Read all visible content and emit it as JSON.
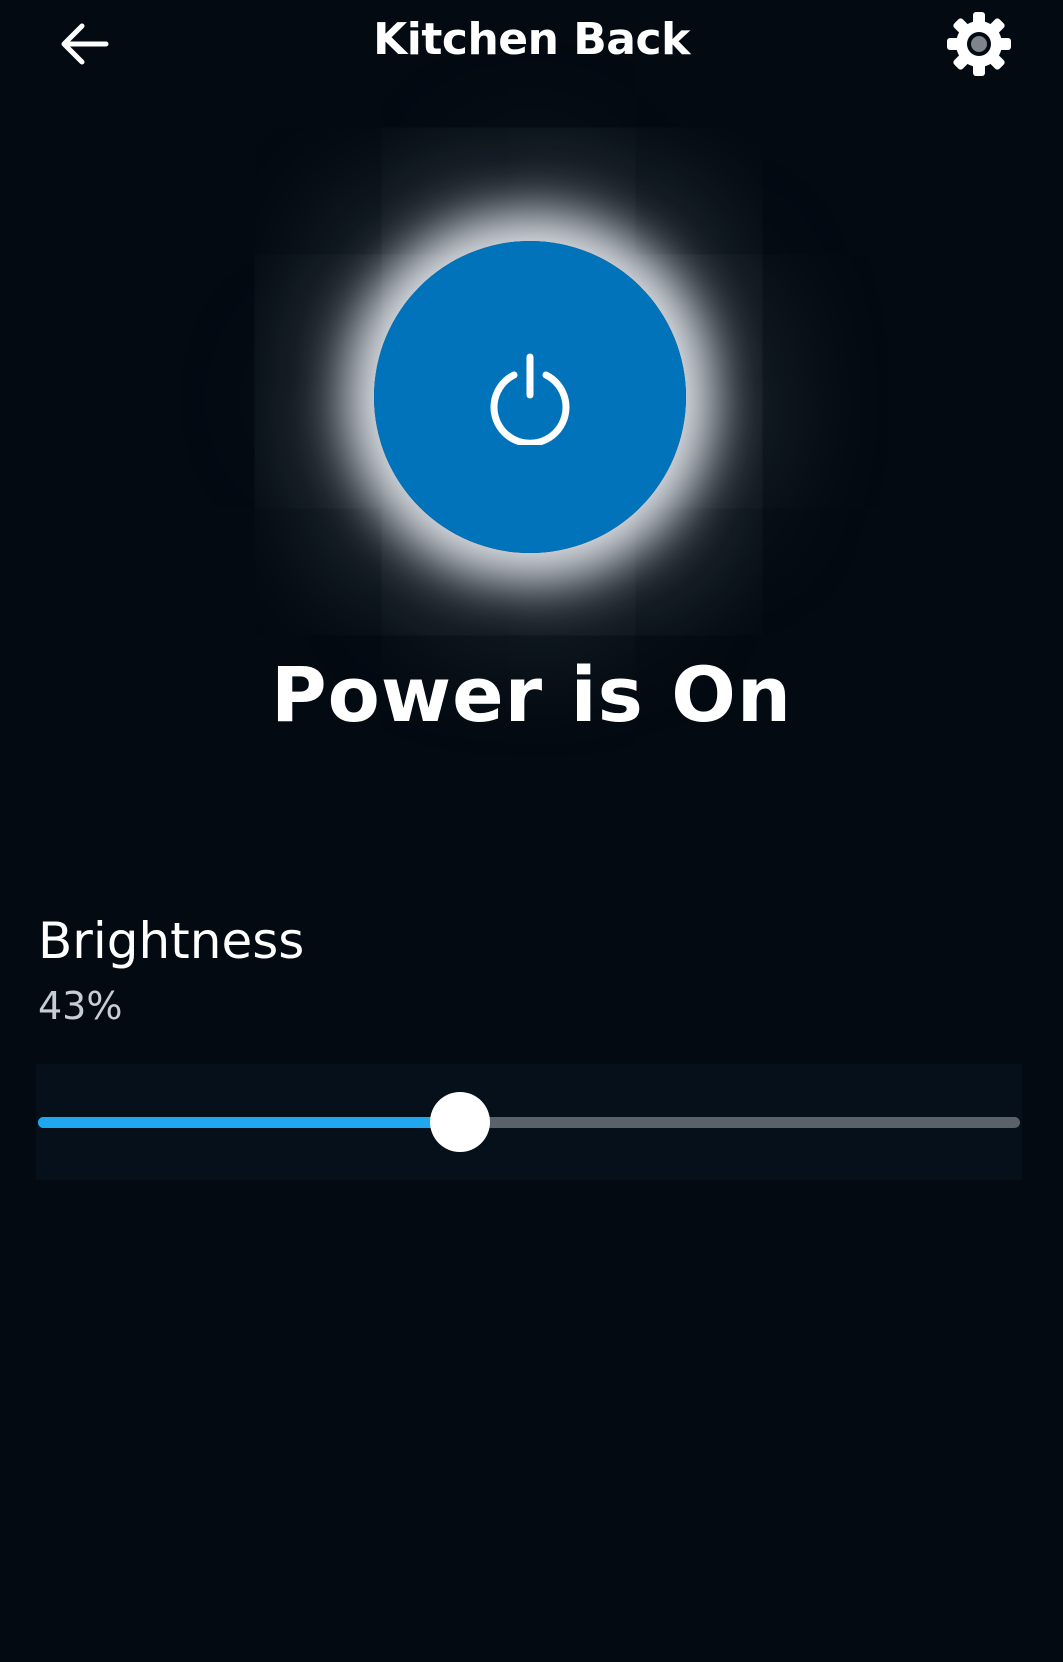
{
  "header": {
    "title": "Kitchen Back",
    "back_icon": "arrow-left-icon",
    "settings_icon": "gear-icon"
  },
  "power": {
    "icon": "power-icon",
    "status_text": "Power is On",
    "is_on": true,
    "button_color": "#0073bb"
  },
  "brightness": {
    "label": "Brightness",
    "value_text": "43%",
    "value": 43,
    "fill_color": "#1fa8ef",
    "track_color": "#5b6168"
  },
  "colors": {
    "background": "#030a12",
    "text": "#ffffff"
  }
}
